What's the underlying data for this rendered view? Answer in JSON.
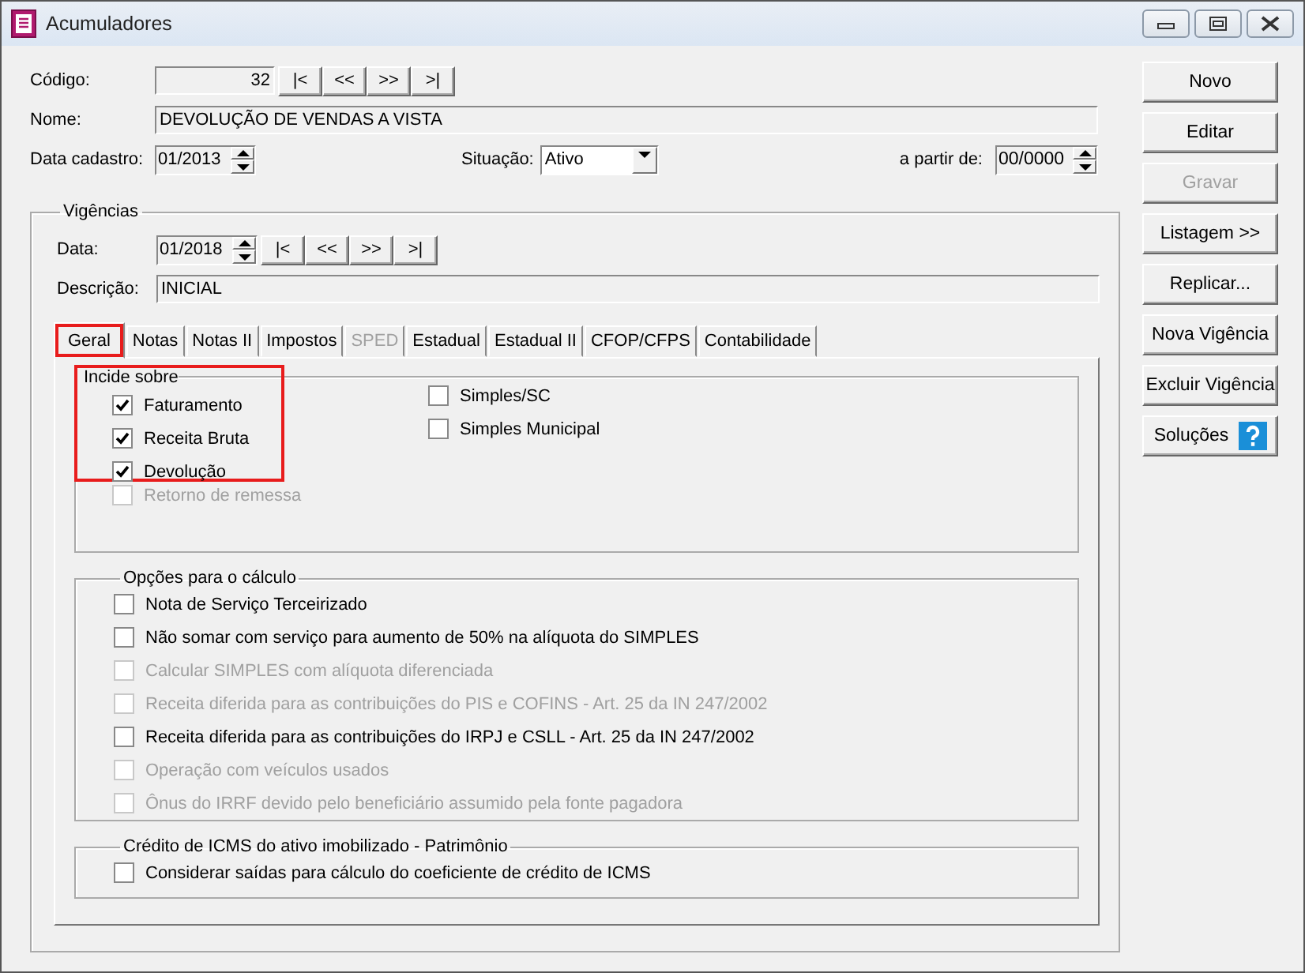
{
  "window": {
    "title": "Acumuladores"
  },
  "record": {
    "codigo_label": "Código:",
    "codigo": "32",
    "nav": [
      "|<",
      "<<",
      ">>",
      ">|"
    ],
    "nome_label": "Nome:",
    "nome": "DEVOLUÇÃO DE VENDAS A VISTA",
    "data_label": "Data cadastro:",
    "data": "01/2013",
    "situacao_label": "Situação:",
    "situacao": "Ativo",
    "partir_label": "a partir de:",
    "partir": "00/0000"
  },
  "vigencias": {
    "title": "Vigências",
    "data_label": "Data:",
    "data": "01/2018",
    "nav": [
      "|<",
      "<<",
      ">>",
      ">|"
    ],
    "descricao_label": "Descrição:",
    "descricao": "INICIAL"
  },
  "tabs": [
    {
      "label": "Geral",
      "selected": true,
      "disabled": false,
      "highlighted": true
    },
    {
      "label": "Notas",
      "selected": false,
      "disabled": false,
      "highlighted": false
    },
    {
      "label": "Notas II",
      "selected": false,
      "disabled": false,
      "highlighted": false
    },
    {
      "label": "Impostos",
      "selected": false,
      "disabled": false,
      "highlighted": false
    },
    {
      "label": "SPED",
      "selected": false,
      "disabled": true,
      "highlighted": false
    },
    {
      "label": "Estadual",
      "selected": false,
      "disabled": false,
      "highlighted": false
    },
    {
      "label": "Estadual II",
      "selected": false,
      "disabled": false,
      "highlighted": false
    },
    {
      "label": "CFOP/CFPS",
      "selected": false,
      "disabled": false,
      "highlighted": false
    },
    {
      "label": "Contabilidade",
      "selected": false,
      "disabled": false,
      "highlighted": false
    }
  ],
  "incide_sobre": {
    "title": "Incide sobre",
    "highlighted": true,
    "left": [
      {
        "label": "Faturamento",
        "checked": true,
        "disabled": false
      },
      {
        "label": "Receita Bruta",
        "checked": true,
        "disabled": false
      },
      {
        "label": "Devolução",
        "checked": true,
        "disabled": false
      }
    ],
    "right": [
      {
        "label": "Simples/SC",
        "checked": false,
        "disabled": false
      },
      {
        "label": "Simples Municipal",
        "checked": false,
        "disabled": false
      }
    ],
    "extra": [
      {
        "label": "Retorno de remessa",
        "checked": false,
        "disabled": true
      }
    ]
  },
  "opcoes": {
    "title": "Opções para o cálculo",
    "items": [
      {
        "label": "Nota de Serviço Terceirizado",
        "checked": false,
        "disabled": false
      },
      {
        "label": "Não somar com serviço para aumento de 50% na alíquota do SIMPLES",
        "checked": false,
        "disabled": false
      },
      {
        "label": "Calcular SIMPLES com alíquota diferenciada",
        "checked": false,
        "disabled": true
      },
      {
        "label": "Receita diferida para as contribuições do PIS e COFINS -  Art. 25 da IN 247/2002",
        "checked": false,
        "disabled": true
      },
      {
        "label": "Receita diferida para as contribuições do IRPJ e CSLL - Art. 25 da IN 247/2002",
        "checked": false,
        "disabled": false
      },
      {
        "label": "Operação com veículos usados",
        "checked": false,
        "disabled": true
      },
      {
        "label": "Ônus do IRRF devido pelo beneficiário assumido pela fonte pagadora",
        "checked": false,
        "disabled": true
      }
    ]
  },
  "credito": {
    "title": "Crédito de ICMS do ativo imobilizado - Patrimônio",
    "items": [
      {
        "label": "Considerar saídas para cálculo do coeficiente de crédito de ICMS",
        "checked": false,
        "disabled": false
      }
    ]
  },
  "buttons": [
    {
      "label": "Novo",
      "disabled": false,
      "help": false
    },
    {
      "label": "Editar",
      "disabled": false,
      "help": false
    },
    {
      "label": "Gravar",
      "disabled": true,
      "help": false
    },
    {
      "label": "Listagem >>",
      "disabled": false,
      "help": false
    },
    {
      "label": "Replicar...",
      "disabled": false,
      "help": false
    },
    {
      "label": "Nova Vigência",
      "disabled": false,
      "help": false
    },
    {
      "label": "Excluir Vigência",
      "disabled": false,
      "help": false
    },
    {
      "label": "Soluções",
      "disabled": false,
      "help": true
    }
  ]
}
